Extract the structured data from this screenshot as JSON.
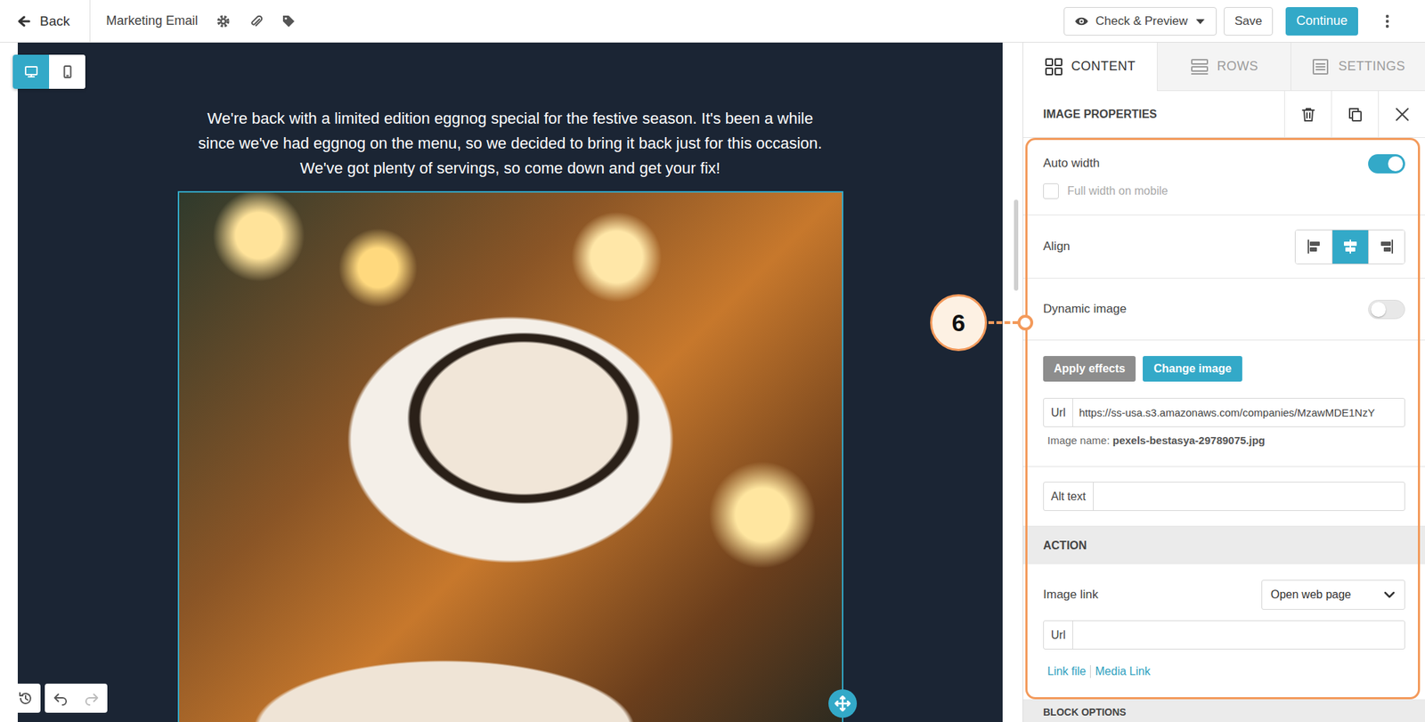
{
  "toolbar": {
    "back": "Back",
    "title": "Marketing Email",
    "check_preview": "Check & Preview",
    "save": "Save",
    "continue": "Continue"
  },
  "device_toggle": {
    "desktop_selected": true,
    "mobile_selected": false
  },
  "canvas": {
    "paragraph": "We're back with a limited edition eggnog special for the festive season. It's been a while since we've had eggnog on the menu, so we decided to bring it back just for this occasion. We've got plenty of servings, so come down and get your fix!",
    "image_selected": true
  },
  "history": {
    "undo_disabled": false,
    "redo_disabled": true
  },
  "panel": {
    "tabs": [
      {
        "label": "CONTENT",
        "selected": true
      },
      {
        "label": "ROWS",
        "selected": false
      },
      {
        "label": "SETTINGS",
        "selected": false
      }
    ],
    "header": "IMAGE PROPERTIES",
    "auto_width": {
      "label": "Auto width",
      "on": true
    },
    "full_width_mobile": {
      "label": "Full width on mobile",
      "checked": false,
      "disabled": true
    },
    "align": {
      "label": "Align",
      "options": [
        {
          "selected": false
        },
        {
          "selected": true
        },
        {
          "selected": false
        }
      ]
    },
    "dynamic_image": {
      "label": "Dynamic image",
      "on": false
    },
    "apply_effects": "Apply effects",
    "change_image": "Change image",
    "url": {
      "label": "Url",
      "value": "https://ss-usa.s3.amazonaws.com/companies/MzawMDE1NzY"
    },
    "image_name": {
      "label": "Image name:",
      "value": "pexels-bestasya-29789075.jpg"
    },
    "alt_text": {
      "label": "Alt text",
      "value": ""
    },
    "action": {
      "header": "ACTION",
      "image_link": {
        "label": "Image link",
        "value": "Open web page"
      },
      "url": {
        "label": "Url",
        "value": ""
      },
      "links": [
        "Link file",
        "Media Link"
      ]
    },
    "block_options": "BLOCK OPTIONS"
  },
  "callout": {
    "number": "6"
  }
}
